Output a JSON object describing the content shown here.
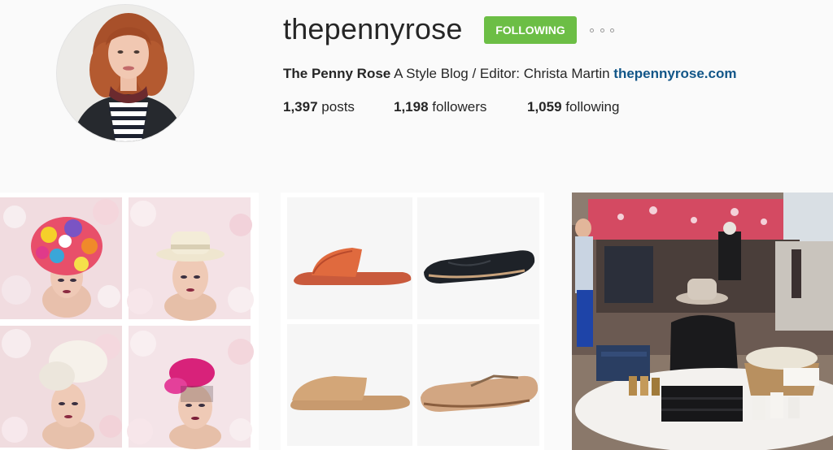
{
  "profile": {
    "username": "thepennyrose",
    "follow_label": "FOLLOWING",
    "more_icon": "ellipsis-icon",
    "full_name": "The Penny Rose",
    "bio_text": "A Style Blog / Editor: Christa Martin",
    "website": "thepennyrose.com"
  },
  "stats": {
    "posts_count": "1,397",
    "posts_label": "posts",
    "followers_count": "1,198",
    "followers_label": "followers",
    "following_count": "1,059",
    "following_label": "following"
  },
  "colors": {
    "follow_button": "#6cbe45",
    "link": "#125688",
    "background": "#fafafa"
  },
  "grid": {
    "posts": [
      {
        "subject": "floral headpiece beauty collage"
      },
      {
        "subject": "flat shoes collage"
      },
      {
        "subject": "boutique store interior"
      }
    ]
  }
}
